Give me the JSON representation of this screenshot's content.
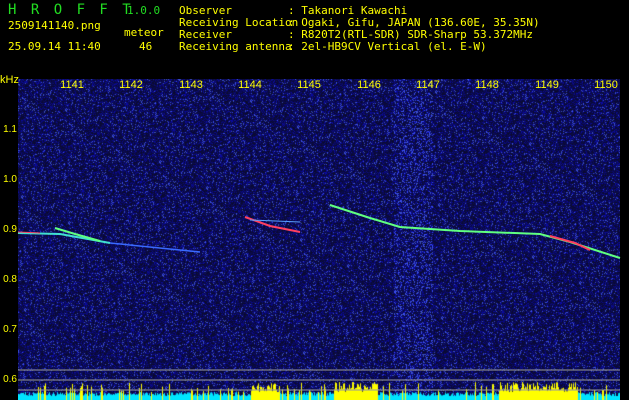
{
  "app": {
    "name": "H R O F F T",
    "version": "1.0.0"
  },
  "file": {
    "name": "2509141140.png",
    "datetime": "25.09.14 11:40"
  },
  "meteor": {
    "label": "meteor",
    "count": "46"
  },
  "info": [
    {
      "label": "Observer",
      "value": ": Takanori Kawachi"
    },
    {
      "label": "Receiving Location",
      "value": ": Ogaki, Gifu, JAPAN (136.60E, 35.35N)"
    },
    {
      "label": "Receiver",
      "value": ": R820T2(RTL-SDR) SDR-Sharp 53.372MHz"
    },
    {
      "label": "Receiving antenna",
      "value": ": 2el-HB9CV Vertical (el. E-W)"
    }
  ],
  "axis": {
    "unit": "kHz",
    "x_ticks": [
      "1141",
      "1142",
      "1143",
      "1144",
      "1145",
      "1146",
      "1147",
      "1148",
      "1149",
      "1150"
    ],
    "y_ticks": [
      "1.1",
      "1.0",
      "0.9",
      "0.8",
      "0.7",
      "0.6"
    ]
  },
  "colors": {
    "background": "#000000",
    "text": "#ffff00",
    "title": "#22dd22",
    "noise": "#1a1a9a",
    "histogram_base": "#00e5ff",
    "histogram_peak": "#ffff00"
  }
}
